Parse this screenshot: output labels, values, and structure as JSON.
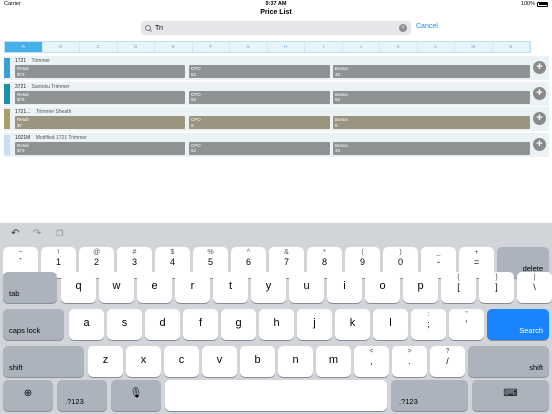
{
  "status": {
    "carrier": "Carrier",
    "time": "9:37 AM",
    "battery": "100%"
  },
  "title": "Price List",
  "search": {
    "value": "Tri",
    "cancel_label": "Cancel"
  },
  "index_tabs": [
    "A",
    "B",
    "C",
    "D",
    "E",
    "F",
    "G",
    "H",
    "I",
    "J",
    "K",
    "L",
    "M",
    "N"
  ],
  "rows": [
    {
      "code": "1721",
      "name": "Trimmer",
      "color": "#3a9fd6",
      "cell_color": "#8e9293",
      "retail_label": "Retail",
      "retail": "$73",
      "cpo_label": "CPO",
      "cpo": "62",
      "bonus_label": "Bonus",
      "bonus": "45"
    },
    {
      "code": "3721",
      "name": "Santoku Trimmer",
      "color": "#1d8fa8",
      "cell_color": "#8e9293",
      "retail_label": "Retail",
      "retail": "$76",
      "cpo_label": "CPO",
      "cpo": "65",
      "bonus_label": "Bonus",
      "bonus": "50"
    },
    {
      "code": "1721...",
      "name": "Trimmer Sheath",
      "color": "#a8a065",
      "cell_color": "#9b9480",
      "retail_label": "Retail",
      "retail": "$7",
      "cpo_label": "CPO",
      "cpo": "6",
      "bonus_label": "Bonus",
      "bonus": "6"
    },
    {
      "code": "1021M",
      "name": "Modified 1721 Trimmer",
      "color": "#c9def0",
      "cell_color": "#8e9293",
      "retail_label": "Retail",
      "retail": "$73",
      "cpo_label": "CPO",
      "cpo": "62",
      "bonus_label": "Bonus",
      "bonus": "45"
    }
  ],
  "keyboard": {
    "toolbar": {
      "undo": "undo-icon",
      "redo": "redo-icon",
      "paste": "paste-icon"
    },
    "number_row": [
      {
        "top": "~",
        "bot": "`"
      },
      {
        "top": "!",
        "bot": "1"
      },
      {
        "top": "@",
        "bot": "2"
      },
      {
        "top": "#",
        "bot": "3"
      },
      {
        "top": "$",
        "bot": "4"
      },
      {
        "top": "%",
        "bot": "5"
      },
      {
        "top": "^",
        "bot": "6"
      },
      {
        "top": "&",
        "bot": "7"
      },
      {
        "top": "*",
        "bot": "8"
      },
      {
        "top": "(",
        "bot": "9"
      },
      {
        "top": ")",
        "bot": "0"
      },
      {
        "top": "_",
        "bot": "-"
      },
      {
        "top": "+",
        "bot": "="
      }
    ],
    "delete": "delete",
    "tab": "tab",
    "qwerty_row": [
      "q",
      "w",
      "e",
      "r",
      "t",
      "y",
      "u",
      "i",
      "o",
      "p"
    ],
    "qwerty_extra": [
      {
        "top": "{",
        "bot": "["
      },
      {
        "top": "}",
        "bot": "]"
      },
      {
        "top": "|",
        "bot": "\\"
      }
    ],
    "caps_lock": "caps lock",
    "home_row": [
      "a",
      "s",
      "d",
      "f",
      "g",
      "h",
      "j",
      "k",
      "l"
    ],
    "home_extra": [
      {
        "top": ":",
        "bot": ";"
      },
      {
        "top": "”",
        "bot": "’"
      }
    ],
    "search": "Search",
    "shift": "shift",
    "bottom_letters": [
      "z",
      "x",
      "c",
      "v",
      "b",
      "n",
      "m"
    ],
    "bottom_extra": [
      {
        "top": "<",
        "bot": ","
      },
      {
        "top": ">",
        "bot": "."
      },
      {
        "top": "?",
        "bot": "/"
      }
    ],
    "numbers_key": ".?123",
    "globe": "globe-icon",
    "mic": "microphone-icon",
    "dismiss": "keyboard-dismiss-icon"
  }
}
